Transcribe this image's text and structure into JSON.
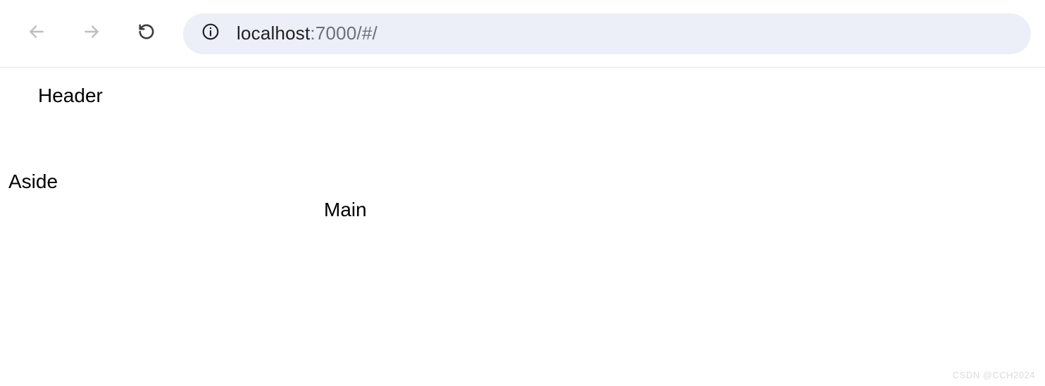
{
  "browser": {
    "url_host": "localhost",
    "url_port": ":7000",
    "url_path": "/#/"
  },
  "page": {
    "header": "Header",
    "aside": "Aside",
    "main": "Main"
  },
  "watermark": "CSDN @CCH2024"
}
